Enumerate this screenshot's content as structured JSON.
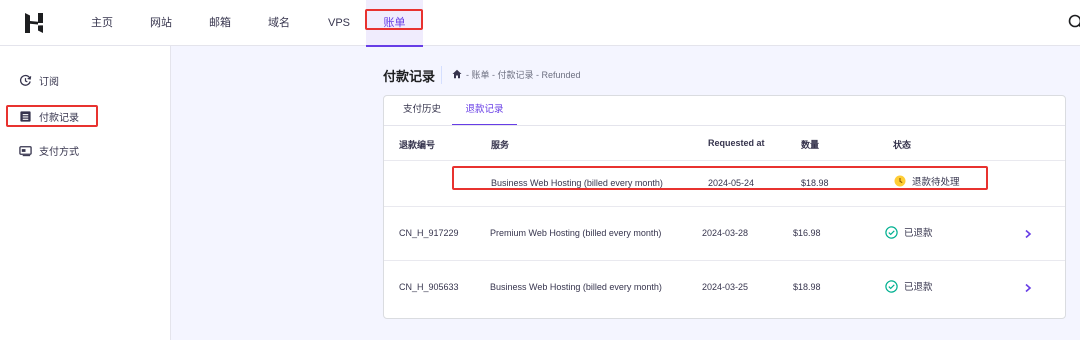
{
  "nav": {
    "items": [
      {
        "label": "主页"
      },
      {
        "label": "网站"
      },
      {
        "label": "邮箱"
      },
      {
        "label": "域名"
      },
      {
        "label": "VPS"
      },
      {
        "label": "账单"
      }
    ],
    "active": "账单"
  },
  "sidebar": {
    "items": [
      {
        "label": "订阅",
        "icon": "subscription-icon"
      },
      {
        "label": "付款记录",
        "icon": "receipt-icon"
      },
      {
        "label": "支付方式",
        "icon": "payment-card-icon"
      }
    ]
  },
  "page": {
    "title": "付款记录",
    "breadcrumb": "- 账单 - 付款记录 - Refunded"
  },
  "tabs": [
    {
      "label": "支付历史"
    },
    {
      "label": "退款记录"
    }
  ],
  "table": {
    "headers": [
      "退款编号",
      "服务",
      "Requested at",
      "数量",
      "状态"
    ],
    "rows": [
      {
        "id": "",
        "service": "Business Web Hosting (billed every month)",
        "date": "2024-05-24",
        "amount": "$18.98",
        "status": "退款待处理",
        "status_type": "pending"
      },
      {
        "id": "CN_H_917229",
        "service": "Premium Web Hosting (billed every month)",
        "date": "2024-03-28",
        "amount": "$16.98",
        "status": "已退款",
        "status_type": "refunded"
      },
      {
        "id": "CN_H_905633",
        "service": "Business Web Hosting (billed every month)",
        "date": "2024-03-25",
        "amount": "$18.98",
        "status": "已退款",
        "status_type": "refunded"
      }
    ]
  },
  "colors": {
    "accent": "#673de6",
    "highlight": "#e8322f",
    "success": "#00b090",
    "pending": "#ffcd35"
  }
}
